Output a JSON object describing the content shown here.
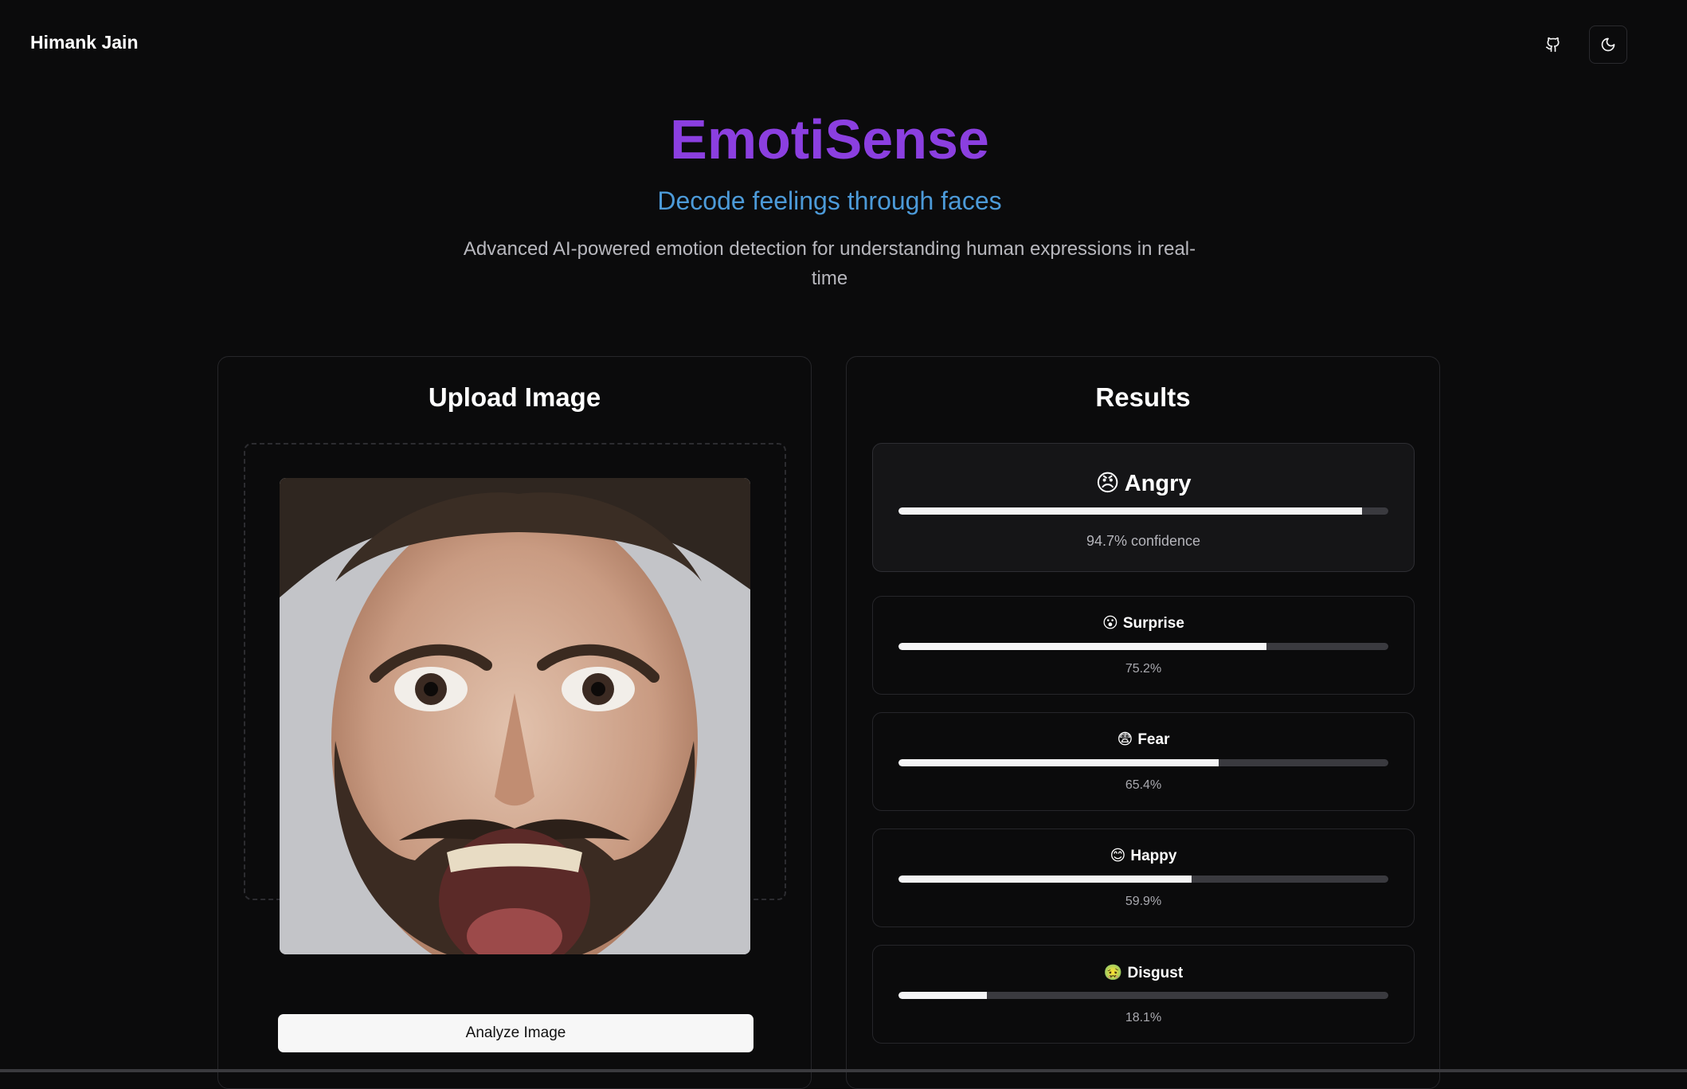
{
  "header": {
    "brand": "Himank Jain",
    "github_icon": "github-icon",
    "theme_icon": "moon-icon"
  },
  "hero": {
    "title": "EmotiSense",
    "subtitle": "Decode feelings through faces",
    "description": "Advanced AI-powered emotion detection for understanding human expressions in real-time"
  },
  "upload": {
    "title": "Upload Image",
    "analyze_label": "Analyze Image"
  },
  "results": {
    "title": "Results",
    "top": {
      "emoji": "😠",
      "label": "Angry",
      "value": 94.7,
      "confidence_text": "94.7% confidence"
    },
    "items": [
      {
        "emoji": "😮",
        "label": "Surprise",
        "value": 75.2,
        "pct_text": "75.2%"
      },
      {
        "emoji": "😨",
        "label": "Fear",
        "value": 65.4,
        "pct_text": "65.4%"
      },
      {
        "emoji": "😊",
        "label": "Happy",
        "value": 59.9,
        "pct_text": "59.9%"
      },
      {
        "emoji": "🤢",
        "label": "Disgust",
        "value": 18.1,
        "pct_text": "18.1%"
      }
    ]
  },
  "colors": {
    "title": "#8b3fe0",
    "subtitle": "#4c9ad8",
    "background": "#0b0b0c"
  }
}
